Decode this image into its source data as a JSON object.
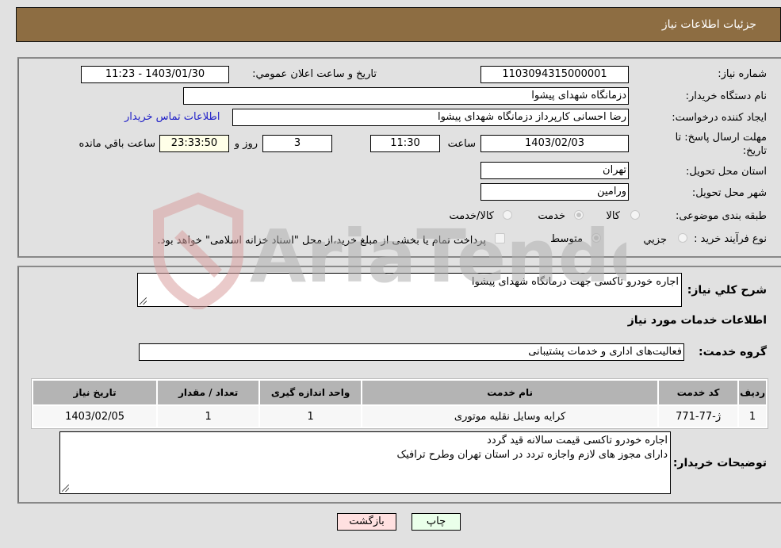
{
  "header": {
    "title": "جزئیات اطلاعات نیاز"
  },
  "form": {
    "need_number_label": "شماره نیاز:",
    "need_number": "1103094315000001",
    "announce_label": "تاریخ و ساعت اعلان عمومي:",
    "announce_value": "1403/01/30 - 11:23",
    "buyer_org_label": "نام دستگاه خریدار:",
    "buyer_org": "دزمانگاه شهدای پیشوا",
    "creator_label": "ایجاد کننده درخواست:",
    "creator": "رضا احسانی کارپرداز دزمانگاه شهدای پیشوا",
    "contact_link": "اطلاعات تماس خریدار",
    "deadline_label": "مهلت ارسال پاسخ: تا تاریخ:",
    "deadline_date": "1403/02/03",
    "time_label": "ساعت",
    "deadline_time": "11:30",
    "days_value": "3",
    "days_label": "روز و",
    "remaining_time": "23:33:50",
    "remaining_label": "ساعت باقي مانده",
    "province_label": "استان محل تحویل:",
    "province": "تهران",
    "city_label": "شهر محل تحویل:",
    "city": "ورامین",
    "category_label": "طبقه بندی موضوعی:",
    "category_options": [
      {
        "label": "کالا",
        "selected": false
      },
      {
        "label": "خدمت",
        "selected": true
      },
      {
        "label": "کالا/خدمت",
        "selected": false
      }
    ],
    "process_label": "نوع فرآیند خرید :",
    "process_options": [
      {
        "label": "جزيي",
        "selected": false
      },
      {
        "label": "متوسط",
        "selected": true
      }
    ],
    "treasury_note": "پرداخت تمام یا بخشی از مبلغ خرید،از محل \"اسناد خزانه اسلامی\" خواهد بود.",
    "treasury_checked": false
  },
  "details": {
    "description_label": "شرح کلي نیاز:",
    "description": "اجاره خودرو تاکسی جهت درمانگاه شهدای پیشوا",
    "services_heading": "اطلاعات خدمات مورد نیاز",
    "service_group_label": "گروه خدمت:",
    "service_group": "فعالیت‌های اداری و خدمات پشتیبانی",
    "table": {
      "headers": [
        "ردیف",
        "کد خدمت",
        "نام خدمت",
        "واحد اندازه گیری",
        "تعداد / مقدار",
        "تاریخ نیاز"
      ],
      "rows": [
        [
          "1",
          "ژ-77-771",
          "کرایه وسایل نقلیه موتوری",
          "1",
          "1",
          "1403/02/05"
        ]
      ]
    },
    "buyer_notes_label": "توضیحات خریدار:",
    "buyer_notes_line1": "اجاره خودرو تاکسی قیمت سالانه قید گردد",
    "buyer_notes_line2": "دارای مجوز های لازم واجازه تردد در استان تهران وطرح ترافیک"
  },
  "buttons": {
    "print": "چاپ",
    "back": "بازگشت"
  },
  "watermark": {
    "text": "AriaTender.neT"
  },
  "colors": {
    "header_bg": "#8d6d42",
    "print_bg": "#eaffea",
    "back_bg": "#ffe0e0",
    "link": "#2020c8"
  }
}
